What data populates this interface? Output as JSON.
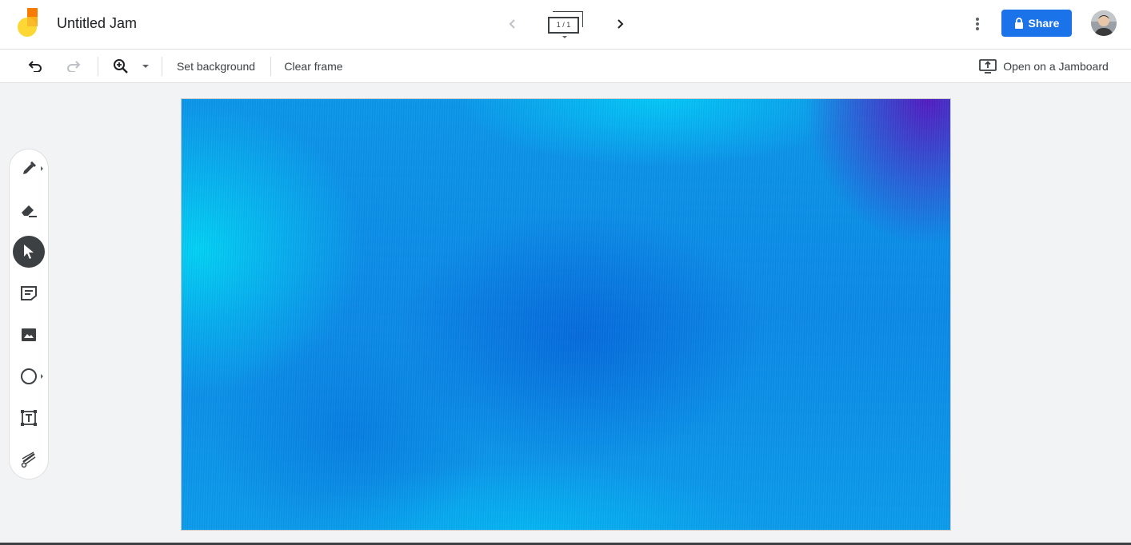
{
  "header": {
    "doc_title": "Untitled Jam",
    "frame_indicator": "1 / 1",
    "share_label": "Share"
  },
  "toolbar": {
    "set_background_label": "Set background",
    "clear_frame_label": "Clear frame",
    "open_on_jamboard_label": "Open on a Jamboard"
  },
  "sidebar": {
    "tools": [
      {
        "name": "pen-tool",
        "icon": "pen-icon"
      },
      {
        "name": "eraser-tool",
        "icon": "eraser-icon"
      },
      {
        "name": "select-tool",
        "icon": "cursor-icon",
        "active": true
      },
      {
        "name": "sticky-note-tool",
        "icon": "sticky-note-icon"
      },
      {
        "name": "image-tool",
        "icon": "image-icon"
      },
      {
        "name": "shape-tool",
        "icon": "circle-icon"
      },
      {
        "name": "text-box-tool",
        "icon": "text-box-icon"
      },
      {
        "name": "laser-tool",
        "icon": "laser-icon"
      }
    ]
  },
  "colors": {
    "share_button": "#1a73e8",
    "active_tool": "#3c4043",
    "canvas_background": "#0a88e6"
  }
}
